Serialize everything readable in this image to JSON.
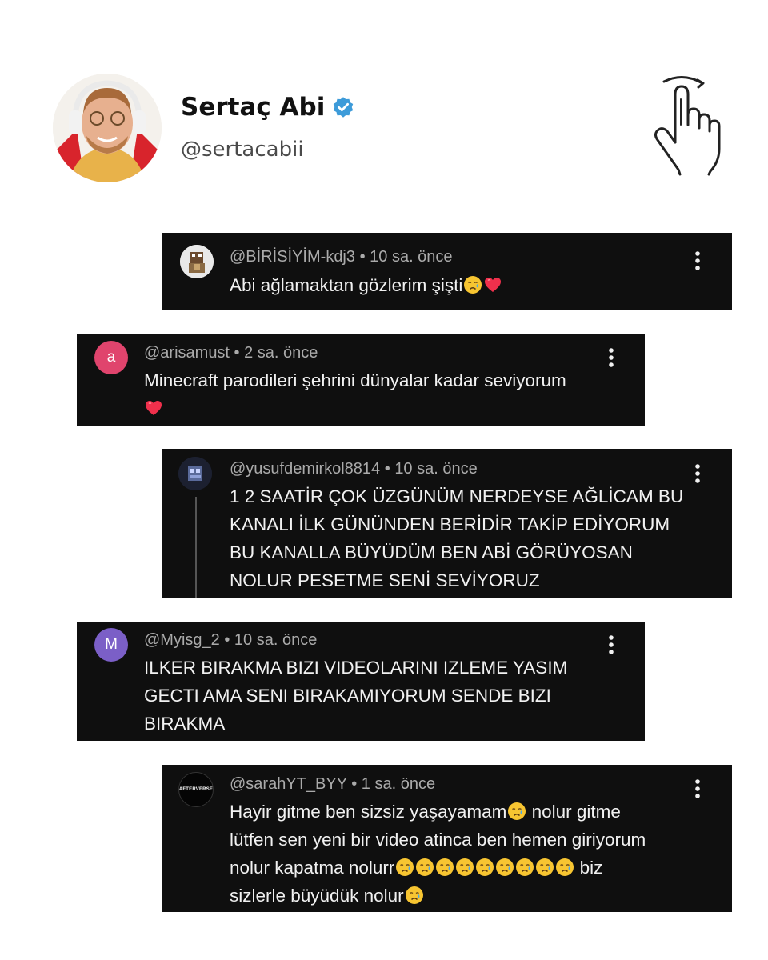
{
  "profile": {
    "name": "Sertaç Abi",
    "handle": "@sertacabii",
    "verified_color": "#3d9bd9"
  },
  "comments": [
    {
      "author": "@BİRİSİYİM-kdj3",
      "time": "10 sa. önce",
      "text": "Abi ağlamaktan gözlerim şişti",
      "avatar": "avatar-image"
    },
    {
      "author": "@arisamust",
      "time": "2 sa. önce",
      "text": "Minecraft parodileri şehrini dünyalar kadar seviyorum",
      "avatar_letter": "a",
      "avatar_color": "#e0446d"
    },
    {
      "author": "@yusufdemirkol8814",
      "time": "10 sa. önce",
      "text": "1  2 SAATİR ÇOK ÜZGÜNÜM NERDEYSE AĞLİCAM BU\nKANALI İLK   GÜNÜNDEN BERİDİR TAKİP EDİYORUM\nBU KANALLA BÜYÜDÜM BEN   ABİ GÖRÜYOSAN\nNOLUR PESETME SENİ SEVİYORUZ",
      "avatar": "avatar-image"
    },
    {
      "author": "@Myisg_2",
      "time": "10 sa. önce",
      "text": "ILKER BIRAKMA BIZI VIDEOLARINI IZLEME YASIM\nGECTI AMA SENI BIRAKAMIYORUM SENDE BIZI\nBIRAKMA",
      "avatar_letter": "M",
      "avatar_color": "#7b5fc7"
    },
    {
      "author": "@sarahYT_BYY",
      "time": "1 sa. önce",
      "text_1": "Hayir gitme ben sizsiz yaşayamam",
      "text_2": " nolur gitme\nlütfen sen yeni bir video atinca ben hemen giriyorum\nnolur kapatma nolurr",
      "text_3": " biz\nsizlerle büyüdük nolur",
      "avatar_text": "AFTERVERSE"
    }
  ],
  "icons": {
    "more": "more-vert-icon",
    "crying": "crying-face-emoji",
    "heart": "red-heart-emoji",
    "hand": "swipe-hand-icon"
  }
}
